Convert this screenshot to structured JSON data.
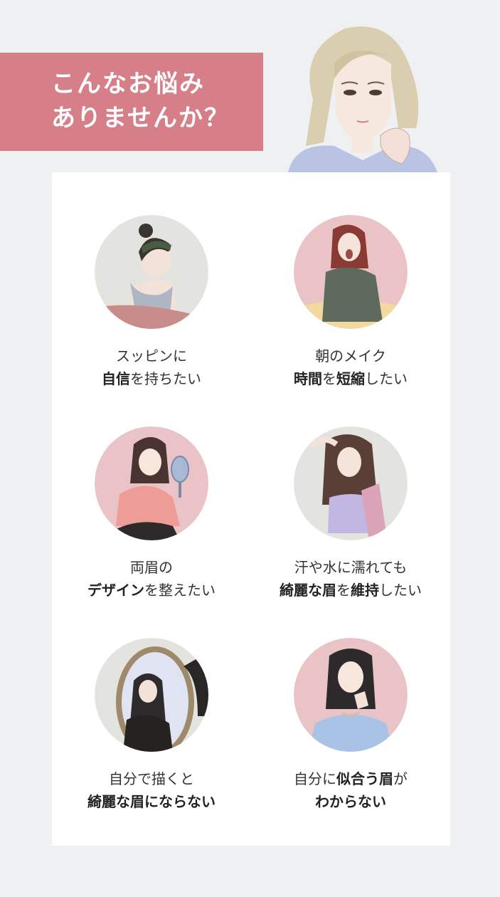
{
  "header": {
    "line1": "こんなお悩み",
    "line2": "ありませんか？"
  },
  "colors": {
    "accent": "#d77f88",
    "page_bg": "#eff0f2",
    "card_bg": "#ffffff",
    "pink_circle": "#e9c3c6",
    "gray_circle": "#e3e3df"
  },
  "items": [
    {
      "image": "woman-headband-tank-top",
      "line1": [
        {
          "t": "スッピンに",
          "b": false
        }
      ],
      "line2": [
        {
          "t": "自信",
          "b": true
        },
        {
          "t": "を持ちたい",
          "b": false
        }
      ]
    },
    {
      "image": "woman-yawning-sweater",
      "line1": [
        {
          "t": "朝のメイク",
          "b": false
        }
      ],
      "line2": [
        {
          "t": "時間",
          "b": true
        },
        {
          "t": "を",
          "b": false
        },
        {
          "t": "短縮",
          "b": true
        },
        {
          "t": "したい",
          "b": false
        }
      ]
    },
    {
      "image": "woman-hand-mirror",
      "line1": [
        {
          "t": "両眉の",
          "b": false
        }
      ],
      "line2": [
        {
          "t": "デザイン",
          "b": true
        },
        {
          "t": "を整えたい",
          "b": false
        }
      ]
    },
    {
      "image": "woman-towel-sweat",
      "line1": [
        {
          "t": "汗や水に濡れても",
          "b": false
        }
      ],
      "line2": [
        {
          "t": "綺麗な眉",
          "b": true
        },
        {
          "t": "を",
          "b": false
        },
        {
          "t": "維持",
          "b": true
        },
        {
          "t": "したい",
          "b": false
        }
      ]
    },
    {
      "image": "woman-wall-mirror",
      "line1": [
        {
          "t": "自分で描くと",
          "b": false
        }
      ],
      "line2": [
        {
          "t": "綺麗な眉にならない",
          "b": true
        }
      ]
    },
    {
      "image": "woman-thinking",
      "line1": [
        {
          "t": "自分に",
          "b": false
        },
        {
          "t": "似合う眉",
          "b": true
        },
        {
          "t": "が",
          "b": false
        }
      ],
      "line2": [
        {
          "t": "わからない",
          "b": true
        }
      ]
    }
  ]
}
